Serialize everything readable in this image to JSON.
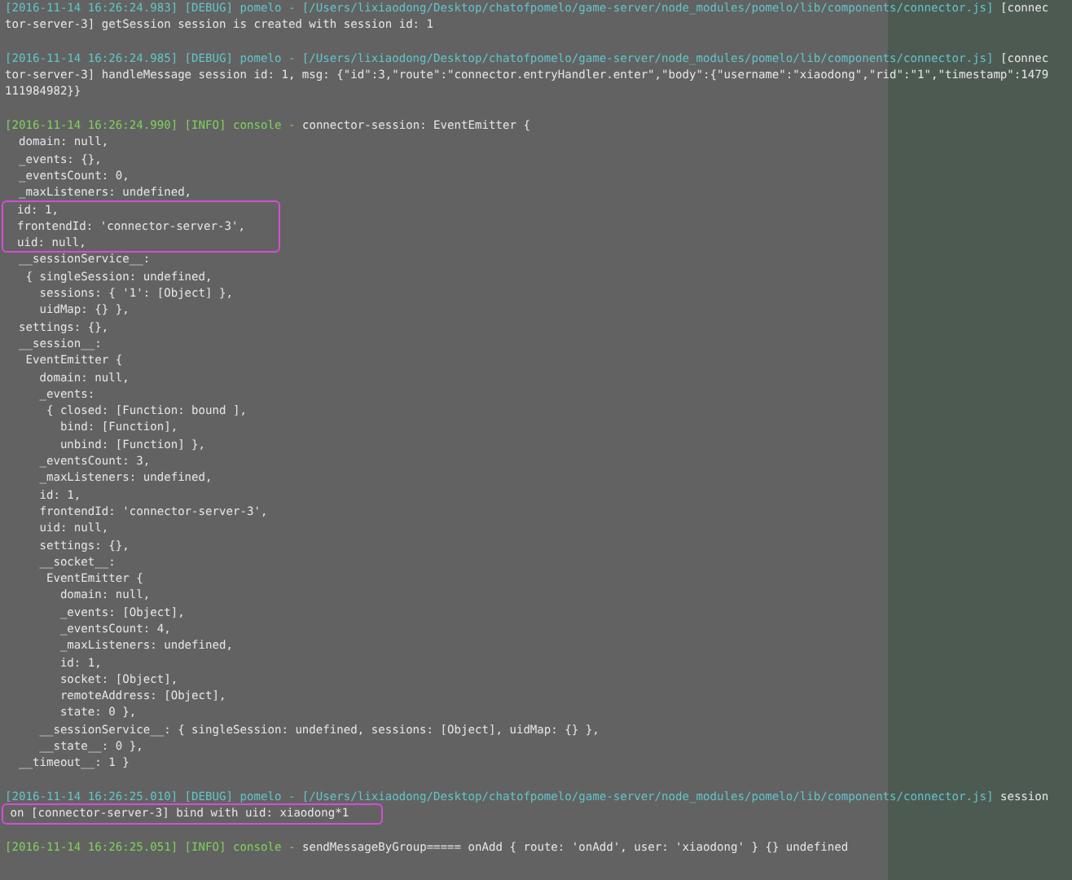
{
  "entries": [
    {
      "kind": "debug",
      "header": "[2016-11-14 16:26:24.983] [DEBUG] pomelo - [/Users/lixiaodong/Desktop/chatofpomelo/game-server/node_modules/pomelo/lib/components/connector.js]",
      "message": "[connec",
      "continuation": [
        "tor-server-3] getSession session is created with session id: 1"
      ]
    },
    {
      "kind": "blank"
    },
    {
      "kind": "debug",
      "header": "[2016-11-14 16:26:24.985] [DEBUG] pomelo - [/Users/lixiaodong/Desktop/chatofpomelo/game-server/node_modules/pomelo/lib/components/connector.js]",
      "message": "[connec",
      "continuation": [
        "tor-server-3] handleMessage session id: 1, msg: {\"id\":3,\"route\":\"connector.entryHandler.enter\",\"body\":{\"username\":\"xiaodong\",\"rid\":\"1\",\"timestamp\":1479",
        "111984982}}"
      ]
    },
    {
      "kind": "blank"
    },
    {
      "kind": "info",
      "header": "[2016-11-14 16:26:24.990] [INFO] console -",
      "message": "connector-session: EventEmitter {"
    },
    {
      "kind": "text",
      "text": "  domain: null,"
    },
    {
      "kind": "text",
      "text": "  _events: {},"
    },
    {
      "kind": "text",
      "text": "  _eventsCount: 0,"
    },
    {
      "kind": "text",
      "text": "  _maxListeners: undefined,"
    },
    {
      "kind": "highlight",
      "lines": [
        "  id: 1,",
        "  frontendId: 'connector-server-3',",
        "  uid: null,"
      ]
    },
    {
      "kind": "text",
      "text": "  __sessionService__:"
    },
    {
      "kind": "text",
      "text": "   { singleSession: undefined,"
    },
    {
      "kind": "text",
      "text": "     sessions: { '1': [Object] },"
    },
    {
      "kind": "text",
      "text": "     uidMap: {} },"
    },
    {
      "kind": "text",
      "text": "  settings: {},"
    },
    {
      "kind": "text",
      "text": "  __session__:"
    },
    {
      "kind": "text",
      "text": "   EventEmitter {"
    },
    {
      "kind": "text",
      "text": "     domain: null,"
    },
    {
      "kind": "text",
      "text": "     _events:"
    },
    {
      "kind": "text",
      "text": "      { closed: [Function: bound ],"
    },
    {
      "kind": "text",
      "text": "        bind: [Function],"
    },
    {
      "kind": "text",
      "text": "        unbind: [Function] },"
    },
    {
      "kind": "text",
      "text": "     _eventsCount: 3,"
    },
    {
      "kind": "text",
      "text": "     _maxListeners: undefined,"
    },
    {
      "kind": "text",
      "text": "     id: 1,"
    },
    {
      "kind": "text",
      "text": "     frontendId: 'connector-server-3',"
    },
    {
      "kind": "text",
      "text": "     uid: null,"
    },
    {
      "kind": "text",
      "text": "     settings: {},"
    },
    {
      "kind": "text",
      "text": "     __socket__:"
    },
    {
      "kind": "text",
      "text": "      EventEmitter {"
    },
    {
      "kind": "text",
      "text": "        domain: null,"
    },
    {
      "kind": "text",
      "text": "        _events: [Object],"
    },
    {
      "kind": "text",
      "text": "        _eventsCount: 4,"
    },
    {
      "kind": "text",
      "text": "        _maxListeners: undefined,"
    },
    {
      "kind": "text",
      "text": "        id: 1,"
    },
    {
      "kind": "text",
      "text": "        socket: [Object],"
    },
    {
      "kind": "text",
      "text": "        remoteAddress: [Object],"
    },
    {
      "kind": "text",
      "text": "        state: 0 },"
    },
    {
      "kind": "text",
      "text": "     __sessionService__: { singleSession: undefined, sessions: [Object], uidMap: {} },"
    },
    {
      "kind": "text",
      "text": "     __state__: 0 },"
    },
    {
      "kind": "text",
      "text": "  __timeout__: 1 }"
    },
    {
      "kind": "blank"
    },
    {
      "kind": "debug",
      "header": "[2016-11-14 16:26:25.010] [DEBUG] pomelo - [/Users/lixiaodong/Desktop/chatofpomelo/game-server/node_modules/pomelo/lib/components/connector.js]",
      "message": "session"
    },
    {
      "kind": "highlight",
      "lines": [
        " on [connector-server-3] bind with uid: xiaodong*1"
      ]
    },
    {
      "kind": "blank"
    },
    {
      "kind": "info",
      "header": "[2016-11-14 16:26:25.051] [INFO] console -",
      "message": "sendMessageByGroup===== onAdd { route: 'onAdd', user: 'xiaodong' } {} undefined"
    }
  ]
}
